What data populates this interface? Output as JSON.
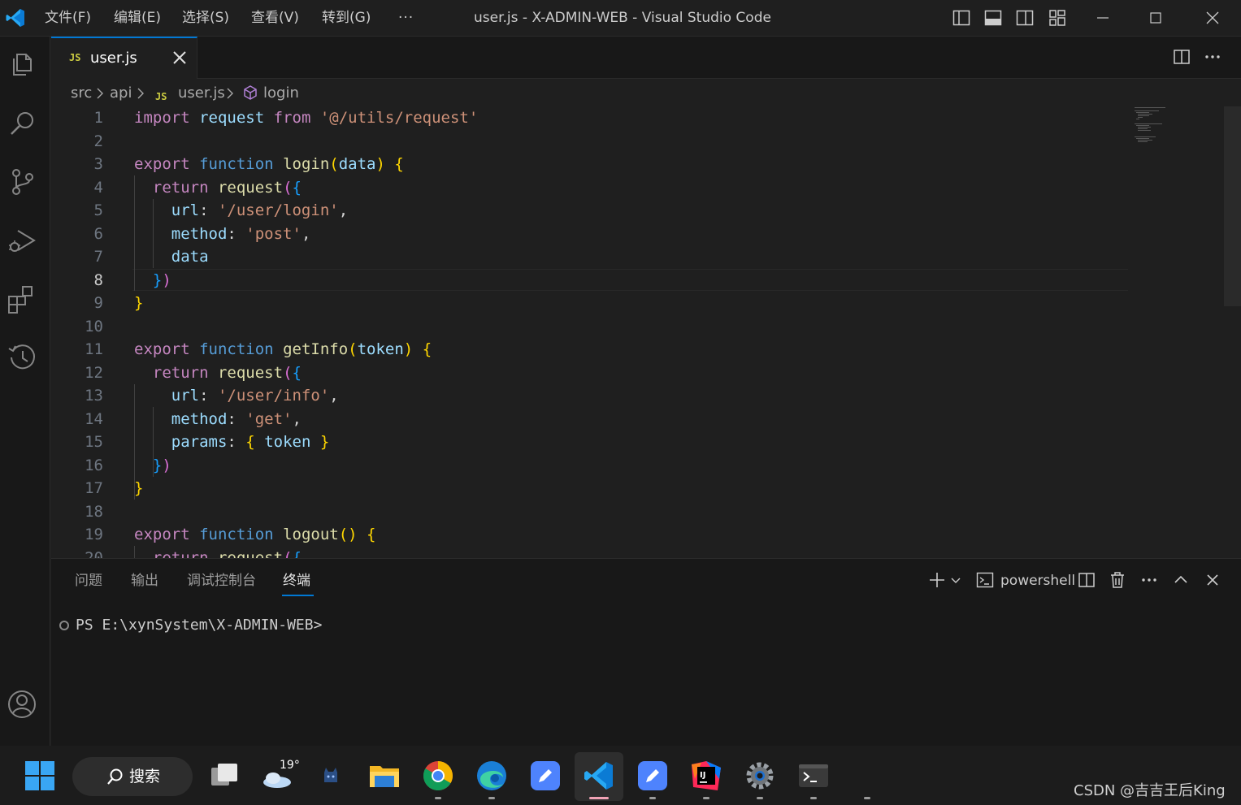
{
  "window": {
    "title": "user.js - X-ADMIN-WEB - Visual Studio Code",
    "menus": [
      "文件(F)",
      "编辑(E)",
      "选择(S)",
      "查看(V)",
      "转到(G)"
    ],
    "more": "···"
  },
  "tab": {
    "badge": "JS",
    "label": "user.js"
  },
  "breadcrumb": {
    "items": [
      "src",
      "api",
      "user.js",
      "login"
    ],
    "file_badge": "JS"
  },
  "editor": {
    "active_line": 8,
    "line_numbers": [
      "1",
      "2",
      "3",
      "4",
      "5",
      "6",
      "7",
      "8",
      "9",
      "10",
      "11",
      "12",
      "13",
      "14",
      "15",
      "16",
      "17",
      "18",
      "19",
      "20"
    ],
    "lines": [
      [
        [
          "k",
          "import"
        ],
        [
          "p",
          " "
        ],
        [
          "v",
          "request"
        ],
        [
          "p",
          " "
        ],
        [
          "k",
          "from"
        ],
        [
          "p",
          " "
        ],
        [
          "s",
          "'@/utils/request'"
        ]
      ],
      [],
      [
        [
          "k",
          "export"
        ],
        [
          "p",
          " "
        ],
        [
          "kw",
          "function"
        ],
        [
          "p",
          " "
        ],
        [
          "f",
          "login"
        ],
        [
          "b1",
          "("
        ],
        [
          "v",
          "data"
        ],
        [
          "b1",
          ")"
        ],
        [
          "p",
          " "
        ],
        [
          "b1",
          "{"
        ]
      ],
      [
        [
          "p",
          "  "
        ],
        [
          "k",
          "return"
        ],
        [
          "p",
          " "
        ],
        [
          "f",
          "request"
        ],
        [
          "b2",
          "("
        ],
        [
          "b3",
          "{"
        ]
      ],
      [
        [
          "p",
          "    "
        ],
        [
          "v",
          "url"
        ],
        [
          "p",
          ": "
        ],
        [
          "s",
          "'/user/login'"
        ],
        [
          "p",
          ","
        ]
      ],
      [
        [
          "p",
          "    "
        ],
        [
          "v",
          "method"
        ],
        [
          "p",
          ": "
        ],
        [
          "s",
          "'post'"
        ],
        [
          "p",
          ","
        ]
      ],
      [
        [
          "p",
          "    "
        ],
        [
          "v",
          "data"
        ]
      ],
      [
        [
          "p",
          "  "
        ],
        [
          "b3",
          "}"
        ],
        [
          "b2",
          ")"
        ]
      ],
      [
        [
          "b1",
          "}"
        ]
      ],
      [],
      [
        [
          "k",
          "export"
        ],
        [
          "p",
          " "
        ],
        [
          "kw",
          "function"
        ],
        [
          "p",
          " "
        ],
        [
          "f",
          "getInfo"
        ],
        [
          "b1",
          "("
        ],
        [
          "v",
          "token"
        ],
        [
          "b1",
          ")"
        ],
        [
          "p",
          " "
        ],
        [
          "b1",
          "{"
        ]
      ],
      [
        [
          "p",
          "  "
        ],
        [
          "k",
          "return"
        ],
        [
          "p",
          " "
        ],
        [
          "f",
          "request"
        ],
        [
          "b2",
          "("
        ],
        [
          "b3",
          "{"
        ]
      ],
      [
        [
          "p",
          "    "
        ],
        [
          "v",
          "url"
        ],
        [
          "p",
          ": "
        ],
        [
          "s",
          "'/user/info'"
        ],
        [
          "p",
          ","
        ]
      ],
      [
        [
          "p",
          "    "
        ],
        [
          "v",
          "method"
        ],
        [
          "p",
          ": "
        ],
        [
          "s",
          "'get'"
        ],
        [
          "p",
          ","
        ]
      ],
      [
        [
          "p",
          "    "
        ],
        [
          "v",
          "params"
        ],
        [
          "p",
          ": "
        ],
        [
          "b1",
          "{"
        ],
        [
          "p",
          " "
        ],
        [
          "v",
          "token"
        ],
        [
          "p",
          " "
        ],
        [
          "b1",
          "}"
        ]
      ],
      [
        [
          "p",
          "  "
        ],
        [
          "b3",
          "}"
        ],
        [
          "b2",
          ")"
        ]
      ],
      [
        [
          "b1",
          "}"
        ]
      ],
      [],
      [
        [
          "k",
          "export"
        ],
        [
          "p",
          " "
        ],
        [
          "kw",
          "function"
        ],
        [
          "p",
          " "
        ],
        [
          "f",
          "logout"
        ],
        [
          "b1",
          "()"
        ],
        [
          "p",
          " "
        ],
        [
          "b1",
          "{"
        ]
      ],
      [
        [
          "p",
          "  "
        ],
        [
          "k",
          "return"
        ],
        [
          "p",
          " "
        ],
        [
          "f",
          "request"
        ],
        [
          "b2",
          "("
        ],
        [
          "b3",
          "{"
        ]
      ]
    ]
  },
  "panel": {
    "tabs": [
      "问题",
      "输出",
      "调试控制台",
      "终端"
    ],
    "active_tab": "终端",
    "shell": "powershell",
    "prompt": "PS E:\\xynSystem\\X-ADMIN-WEB>"
  },
  "taskbar": {
    "search_label": "搜索",
    "weather_temp": "19°",
    "watermark": "CSDN @吉吉王后King"
  },
  "colors": {
    "accent": "#0078d4",
    "editor_bg": "#1f1f1f",
    "js_badge": "#cbcb41"
  }
}
